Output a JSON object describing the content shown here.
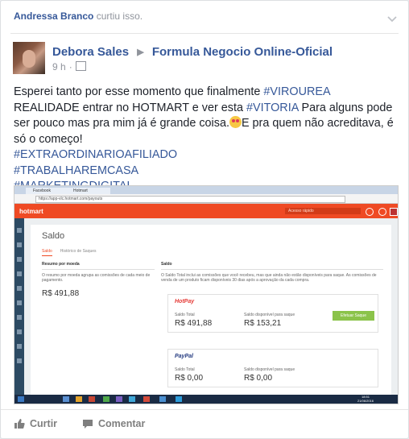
{
  "story": {
    "liked_by": "Andressa Branco",
    "liked_text": "curtiu isso."
  },
  "post": {
    "author": "Debora Sales",
    "target_page": "Formula Negocio Online-Oficial",
    "time": "9 h",
    "text_parts": {
      "p1": "Esperei tanto por esse momento que finalmente ",
      "tag1": "#VIROUREA",
      "p2": " REALIDADE entrar no HOTMART e ver esta ",
      "tag2": "#VITORIA",
      "p3": " Para alguns pode ser pouco mas pra mim já é grande coisa.",
      "p4": "E pra quem não acreditava, é só o começo!",
      "tag3": "#EXTRAORDINARIOAFILIADO",
      "tag4": "#TRABALHAREMCASA",
      "tag5": "#MARKETINGDIGITAL"
    }
  },
  "screenshot": {
    "tab1": "Facebook",
    "tab2": "Hotmart",
    "url": "https://app-vlc.hotmart.com/payouts",
    "logo": "hotmart",
    "search_placeholder": "Acesso rápido",
    "page_title": "Saldo",
    "tab_saldo": "Saldo",
    "tab_historico": "Histórico de Saques",
    "left_head": "Resumo por moeda",
    "left_desc": "O resumo por moeda agrupa as comissões de cada meio de pagamento.",
    "left_value": "R$ 491,88",
    "right_head": "Saldo",
    "right_desc": "O Saldo Total inclui as comissões que você recebeu, mas que ainda não estão disponíveis para saque. As comissões de venda de um produto ficam disponíveis 30 dias após a aprovação da cada compra.",
    "hotpay_label": "HotPay",
    "total_label": "Saldo Total",
    "available_label": "Saldo disponível para saque",
    "hotpay_total": "R$ 491,88",
    "hotpay_available": "R$ 153,21",
    "withdraw_button": "Efetuar Saque",
    "paypal_label": "PayPal",
    "paypal_total": "R$ 0,00",
    "paypal_available": "R$ 0,00",
    "clock_time": "18:51",
    "clock_date": "21/06/2016"
  },
  "actions": {
    "like": "Curtir",
    "comment": "Comentar"
  },
  "colors": {
    "link": "#365899",
    "hotmart": "#ef4a24"
  }
}
